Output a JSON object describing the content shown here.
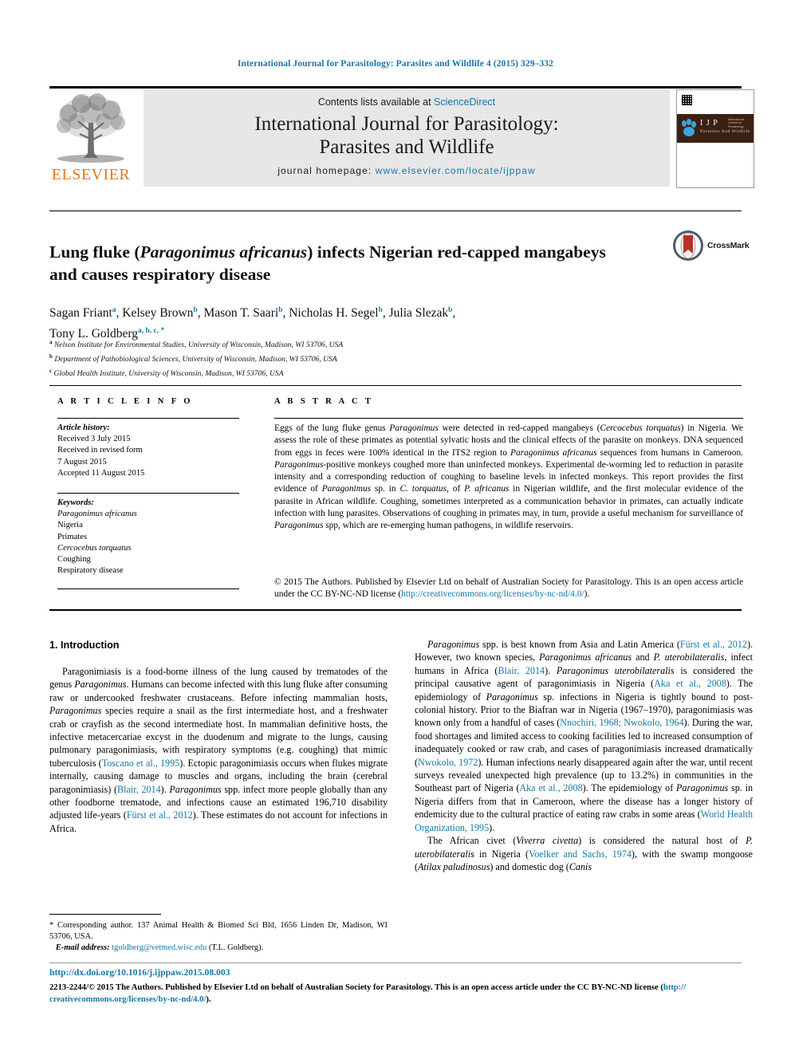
{
  "running_head": "International Journal for Parasitology: Parasites and Wildlife 4 (2015) 329–332",
  "masthead": {
    "publisher_name": "ELSEVIER",
    "contents_prefix": "Contents lists available at ",
    "contents_link": "ScienceDirect",
    "journal_title_line1": "International Journal for Parasitology:",
    "journal_title_line2": "Parasites and Wildlife",
    "homepage_label": "journal homepage: ",
    "homepage_url": "www.elsevier.com/locate/ijppaw",
    "cover": {
      "ijp_text": "I J P",
      "ijp_sub": "Parasites And Wildlife",
      "ijp_corner": "International Journal for Parasitology"
    }
  },
  "article": {
    "title_part1": "Lung fluke (",
    "title_italic": "Paragonimus africanus",
    "title_part2": ") infects Nigerian red-capped mangabeys and causes respiratory disease",
    "crossmark_label": "CrossMark",
    "authors": [
      {
        "name": "Sagan Friant",
        "marks": "a"
      },
      {
        "name": "Kelsey Brown",
        "marks": "b"
      },
      {
        "name": "Mason T. Saari",
        "marks": "b"
      },
      {
        "name": "Nicholas H. Segel",
        "marks": "b"
      },
      {
        "name": "Julia Slezak",
        "marks": "b"
      },
      {
        "name": "Tony L. Goldberg",
        "marks": "a, b, c, *"
      }
    ],
    "affiliations": [
      {
        "mark": "a",
        "text": "Nelson Institute for Environmental Studies, University of Wisconsin, Madison, WI 53706, USA"
      },
      {
        "mark": "b",
        "text": "Department of Pathobiological Sciences, University of Wisconsin, Madison, WI 53706, USA"
      },
      {
        "mark": "c",
        "text": "Global Health Institute, University of Wisconsin, Madison, WI 53706, USA"
      }
    ]
  },
  "article_info": {
    "label": "A R T I C L E  I N F O",
    "history_label": "Article history:",
    "history": [
      "Received 3 July 2015",
      "Received in revised form",
      "7 August 2015",
      "Accepted 11 August 2015"
    ],
    "keywords_label": "Keywords:",
    "keywords": [
      {
        "text": "Paragonimus africanus",
        "italic": true
      },
      {
        "text": "Nigeria",
        "italic": false
      },
      {
        "text": "Primates",
        "italic": false
      },
      {
        "text": "Cercocebus torquatus",
        "italic": true
      },
      {
        "text": "Coughing",
        "italic": false
      },
      {
        "text": "Respiratory disease",
        "italic": false
      }
    ]
  },
  "abstract": {
    "label": "A B S T R A C T",
    "text_segments": [
      {
        "t": "Eggs of the lung fluke genus ",
        "s": "n"
      },
      {
        "t": "Paragonimus",
        "s": "i"
      },
      {
        "t": " were detected in red-capped mangabeys (",
        "s": "n"
      },
      {
        "t": "Cercocebus torquatus",
        "s": "i"
      },
      {
        "t": ") in Nigeria. We assess the role of these primates as potential sylvatic hosts and the clinical effects of the parasite on monkeys. DNA sequenced from eggs in feces were 100% identical in the ITS2 region to ",
        "s": "n"
      },
      {
        "t": "Paragonimus africanus",
        "s": "i"
      },
      {
        "t": " sequences from humans in Cameroon. ",
        "s": "n"
      },
      {
        "t": "Paragonimus",
        "s": "i"
      },
      {
        "t": "-positive monkeys coughed more than uninfected monkeys. Experimental de-worming led to reduction in parasite intensity and a corresponding reduction of coughing to baseline levels in infected monkeys. This report provides the first evidence of ",
        "s": "n"
      },
      {
        "t": "Paragonimus",
        "s": "i"
      },
      {
        "t": " sp. in ",
        "s": "n"
      },
      {
        "t": "C. torquatus",
        "s": "i"
      },
      {
        "t": ", of ",
        "s": "n"
      },
      {
        "t": "P. africanus",
        "s": "i"
      },
      {
        "t": " in Nigerian wildlife, and the first molecular evidence of the parasite in African wildlife. Coughing, sometimes interpreted as a communication behavior in primates, can actually indicate infection with lung parasites. Observations of coughing in primates may, in turn, provide a useful mechanism for surveillance of ",
        "s": "n"
      },
      {
        "t": "Paragonimus",
        "s": "i"
      },
      {
        "t": " spp, which are re-emerging human pathogens, in wildlife reservoirs.",
        "s": "n"
      }
    ],
    "copyright_text": "© 2015 The Authors. Published by Elsevier Ltd on behalf of Australian Society for Parasitology. This is an open access article under the CC BY-NC-ND license (",
    "copyright_link": "http://creativecommons.org/licenses/by-nc-nd/4.0/",
    "copyright_suffix": ")."
  },
  "body": {
    "section_heading": "1.  Introduction",
    "left_column_segments": [
      {
        "t": "Paragonimiasis is a food-borne illness of the lung caused by trematodes of the genus ",
        "s": "n"
      },
      {
        "t": "Paragonimus",
        "s": "i"
      },
      {
        "t": ". Humans can become infected with this lung fluke after consuming raw or undercooked freshwater crustaceans. Before infecting mammalian hosts, ",
        "s": "n"
      },
      {
        "t": "Paragonimus",
        "s": "i"
      },
      {
        "t": " species require a snail as the first intermediate host, and a freshwater crab or crayfish as the second intermediate host. In mammalian definitive hosts, the infective metacercariae excyst in the duodenum and migrate to the lungs, causing pulmonary paragonimiasis, with respiratory symptoms (e.g. coughing) that mimic tuberculosis (",
        "s": "n"
      },
      {
        "t": "Toscano et al., 1995",
        "s": "l"
      },
      {
        "t": "). Ectopic paragonimiasis occurs when flukes migrate internally, causing damage to muscles and organs, including the brain (cerebral paragonimiasis) (",
        "s": "n"
      },
      {
        "t": "Blair, 2014",
        "s": "l"
      },
      {
        "t": "). ",
        "s": "n"
      },
      {
        "t": "Paragonimus",
        "s": "i"
      },
      {
        "t": " spp. infect more people globally than any other foodborne trematode, and infections cause an estimated 196,710 disability adjusted life-years (",
        "s": "n"
      },
      {
        "t": "Fürst et al., 2012",
        "s": "l"
      },
      {
        "t": "). These estimates do not account for infections in Africa.",
        "s": "n"
      }
    ],
    "right_column_p1_segments": [
      {
        "t": "Paragonimus",
        "s": "i"
      },
      {
        "t": " spp. is best known from Asia and Latin America (",
        "s": "n"
      },
      {
        "t": "Fürst et al., 2012",
        "s": "l"
      },
      {
        "t": "). However, two known species, ",
        "s": "n"
      },
      {
        "t": "Paragonimus africanus",
        "s": "i"
      },
      {
        "t": " and ",
        "s": "n"
      },
      {
        "t": "P. uterobilateralis",
        "s": "i"
      },
      {
        "t": ", infect humans in Africa (",
        "s": "n"
      },
      {
        "t": "Blair, 2014",
        "s": "l"
      },
      {
        "t": "). ",
        "s": "n"
      },
      {
        "t": "Paragonimus uterobilateralis",
        "s": "i"
      },
      {
        "t": " is considered the principal causative agent of paragonimiasis in Nigeria (",
        "s": "n"
      },
      {
        "t": "Aka et al., 2008",
        "s": "l"
      },
      {
        "t": "). The epidemiology of ",
        "s": "n"
      },
      {
        "t": "Paragonimus",
        "s": "i"
      },
      {
        "t": " sp. infections in Nigeria is tightly bound to post-colonial history. Prior to the Biafran war in Nigeria (1967–1970), paragonimiasis was known only from a handful of cases (",
        "s": "n"
      },
      {
        "t": "Nnochiri, 1968; Nwokolo, 1964",
        "s": "l"
      },
      {
        "t": "). During the war, food shortages and limited access to cooking facilities led to increased consumption of inadequately cooked or raw crab, and cases of paragonimiasis increased dramatically (",
        "s": "n"
      },
      {
        "t": "Nwokolo, 1972",
        "s": "l"
      },
      {
        "t": "). Human infections nearly disappeared again after the war, until recent surveys revealed unexpected high prevalence (up to 13.2%) in communities in the Southeast part of Nigeria (",
        "s": "n"
      },
      {
        "t": "Aka et al., 2008",
        "s": "l"
      },
      {
        "t": "). The epidemiology of ",
        "s": "n"
      },
      {
        "t": "Paragonimus",
        "s": "i"
      },
      {
        "t": " sp. in Nigeria differs from that in Cameroon, where the disease has a longer history of endemicity due to the cultural practice of eating raw crabs in some areas (",
        "s": "n"
      },
      {
        "t": "World Health Organization, 1995",
        "s": "l"
      },
      {
        "t": ").",
        "s": "n"
      }
    ],
    "right_column_p2_segments": [
      {
        "t": "The African civet (",
        "s": "n"
      },
      {
        "t": "Viverra civetta",
        "s": "i"
      },
      {
        "t": ") is considered the natural host of ",
        "s": "n"
      },
      {
        "t": "P. uterobilateralis",
        "s": "i"
      },
      {
        "t": " in Nigeria (",
        "s": "n"
      },
      {
        "t": "Voelker and Sachs, 1974",
        "s": "l"
      },
      {
        "t": "), with the swamp mongoose (",
        "s": "n"
      },
      {
        "t": "Atilax paludinosus",
        "s": "i"
      },
      {
        "t": ") and domestic dog (",
        "s": "n"
      },
      {
        "t": "Canis",
        "s": "i"
      }
    ]
  },
  "footnote": {
    "corresponding_marker": "*",
    "corresponding_text": "  Corresponding author. 137 Animal Health & Biomed Sci Bld, 1656 Linden Dr, Madison, WI 53706, USA.",
    "email_label": "E-mail address:",
    "email": "tgoldberg@vetmed.wisc.edu",
    "email_owner": "(T.L. Goldberg)."
  },
  "bottom": {
    "doi": "http://dx.doi.org/10.1016/j.ijppaw.2015.08.003",
    "issn_text": "2213-2244/© 2015 The Authors. Published by Elsevier Ltd on behalf of Australian Society for Parasitology. This is an open access article under the CC BY-NC-ND license (",
    "issn_link_part1": "http://",
    "issn_link_part2": "creativecommons.org/licenses/by-nc-nd/4.0/",
    "issn_suffix": ")."
  },
  "colors": {
    "link": "#1477a8",
    "elsevier_orange": "#e87722",
    "masthead_grey": "#e7e7e7",
    "cover_brown": "#3b2114",
    "crossmark_red": "#b4342a"
  }
}
